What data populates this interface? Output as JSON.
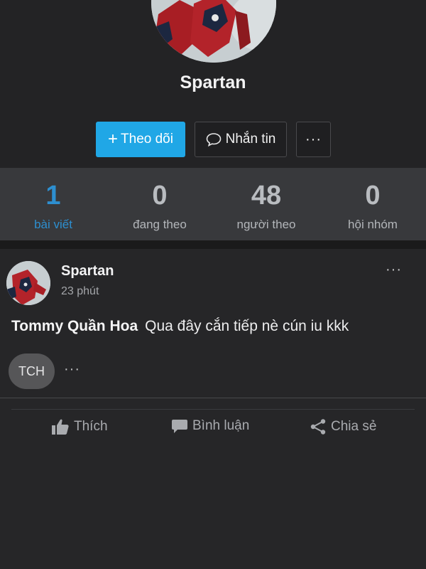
{
  "profile": {
    "name": "Spartan",
    "avatar_icon": "spiderman-avatar-image"
  },
  "actions": {
    "follow_label": "Theo dõi",
    "follow_plus": "+",
    "message_label": "Nhắn tin",
    "more_label": "···"
  },
  "stats": [
    {
      "value": "1",
      "label": "bài viết"
    },
    {
      "value": "0",
      "label": "đang theo"
    },
    {
      "value": "48",
      "label": "người theo"
    },
    {
      "value": "0",
      "label": "hội nhóm"
    }
  ],
  "post": {
    "author": "Spartan",
    "time": "23 phút",
    "menu_label": "···",
    "mention": "Tommy Quần Hoa",
    "text": "Qua đây cắn tiếp nè cún iu kkk",
    "chip_label": "TCH",
    "chip_more": "···",
    "like_label": "Thích",
    "comment_label": "Bình luận",
    "share_label": "Chia sẻ"
  },
  "colors": {
    "accent": "#20a7e6",
    "active_stat": "#2d8fd0",
    "background": "#232325"
  }
}
